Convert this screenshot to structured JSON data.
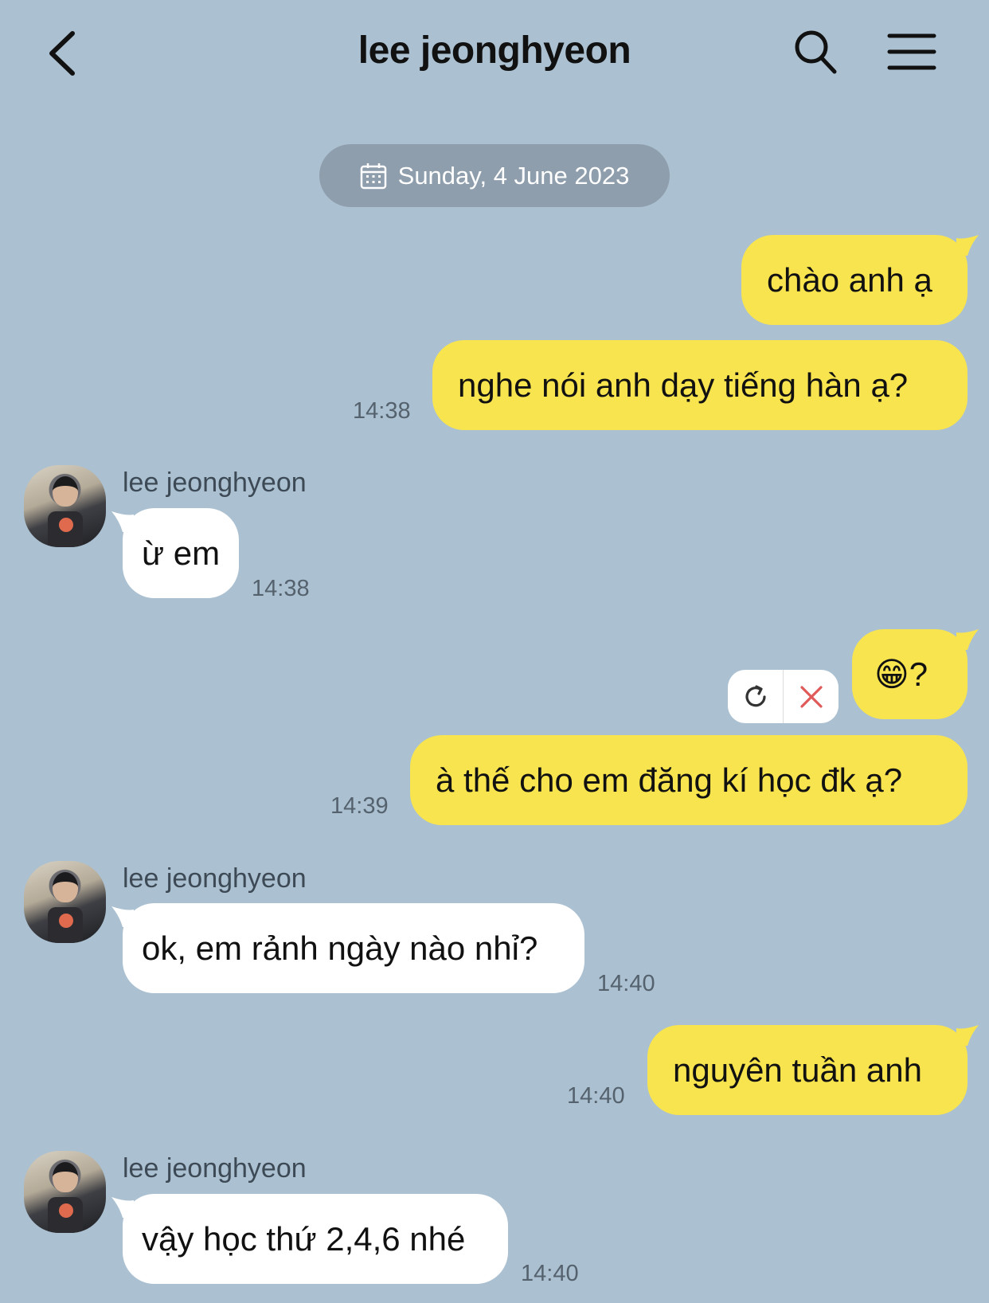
{
  "header": {
    "title": "lee jeonghyeon",
    "back_icon": "chevron-left-icon",
    "search_icon": "search-icon",
    "menu_icon": "hamburger-menu-icon"
  },
  "date_divider": {
    "label": "Sunday, 4 June 2023",
    "icon": "calendar-icon"
  },
  "colors": {
    "background": "#abc1d1",
    "outgoing_bubble": "#f8e44e",
    "incoming_bubble": "#ffffff",
    "date_pill": "#8e9ead",
    "cancel_x": "#e05a5a"
  },
  "messages": [
    {
      "direction": "out",
      "text": "chào anh ạ"
    },
    {
      "direction": "out",
      "text": "nghe nói anh dạy tiếng hàn ạ?",
      "time": "14:38"
    },
    {
      "direction": "in",
      "sender": "lee jeonghyeon",
      "text": "ừ em",
      "time": "14:38"
    },
    {
      "direction": "out",
      "text": "😁?",
      "status": "failed",
      "retry_icon": "refresh-icon",
      "cancel_icon": "close-icon"
    },
    {
      "direction": "out",
      "text": "à thế cho em đăng kí học đk ạ?",
      "time": "14:39"
    },
    {
      "direction": "in",
      "sender": "lee jeonghyeon",
      "text": "ok, em rảnh ngày nào nhỉ?",
      "time": "14:40"
    },
    {
      "direction": "out",
      "text": "nguyên tuần anh",
      "time": "14:40"
    },
    {
      "direction": "in",
      "sender": "lee jeonghyeon",
      "text": "vậy học thứ 2,4,6 nhé",
      "time": "14:40"
    }
  ]
}
